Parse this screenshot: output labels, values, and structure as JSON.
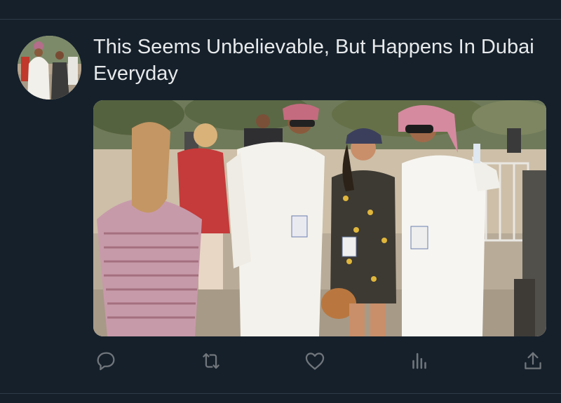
{
  "tweet": {
    "text": "This Seems Unbelievable, But Happens In Dubai Everyday"
  },
  "actions": {
    "reply": "reply-icon",
    "retweet": "retweet-icon",
    "like": "heart-icon",
    "views": "analytics-icon",
    "share": "share-icon"
  },
  "colors": {
    "background": "#15202b",
    "text": "#e7e9ea",
    "icon": "#71767b"
  }
}
